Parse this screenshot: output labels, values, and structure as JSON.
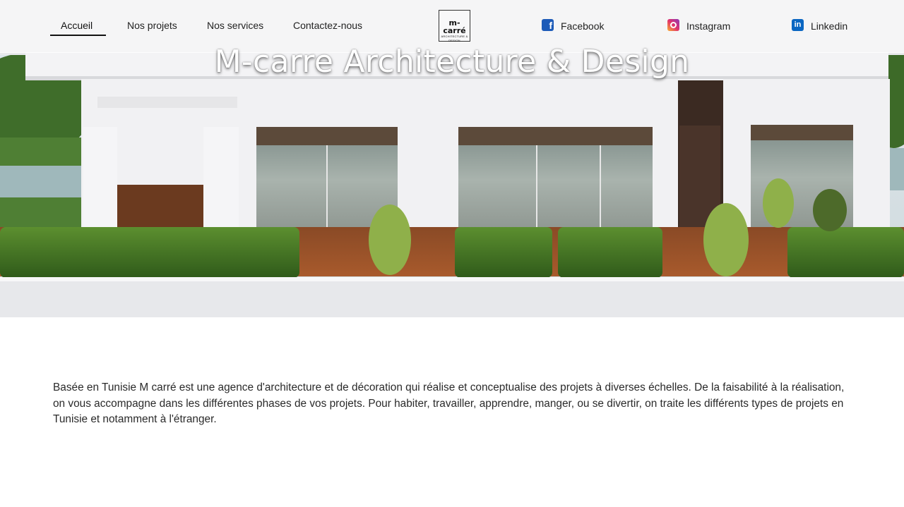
{
  "nav": {
    "links": [
      {
        "label": "Accueil",
        "active": true
      },
      {
        "label": "Nos projets"
      },
      {
        "label": "Nos services"
      },
      {
        "label": "Contactez-nous"
      }
    ]
  },
  "logo": {
    "main": "m-carré",
    "sub": "ARCHITECTURE & DESIGN"
  },
  "social": [
    {
      "label": "Facebook",
      "icon": "facebook-icon"
    },
    {
      "label": "Instagram",
      "icon": "instagram-icon"
    },
    {
      "label": "Linkedin",
      "icon": "linkedin-icon"
    }
  ],
  "hero": {
    "title": "M-carre Architecture & Design"
  },
  "intro": {
    "text": "Basée en Tunisie M carré est une agence d'architecture et de décoration qui réalise et conceptualise des projets à diverses échelles. De la faisabilité à la réalisation, on vous accompagne dans les différentes phases de vos projets. Pour habiter, travailler, apprendre, manger, ou se divertir, on traite les différents types de projets en Tunisie et notamment à l'étranger."
  },
  "colors": {
    "accent": "#111111",
    "facebook": "#1d5bb8",
    "linkedin": "#0a66c2"
  }
}
